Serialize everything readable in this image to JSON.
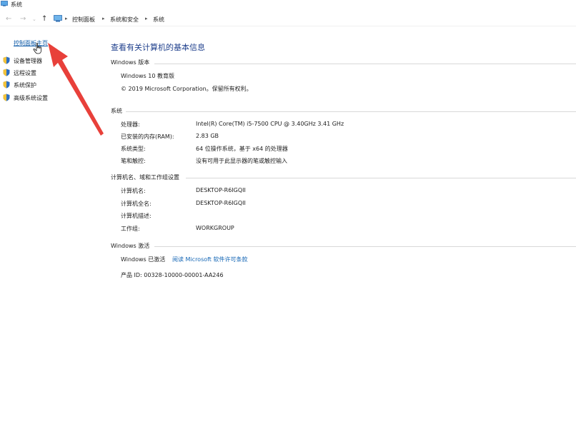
{
  "window": {
    "title": "系统"
  },
  "address": {
    "crumbs": [
      "控制面板",
      "系统和安全",
      "系统"
    ]
  },
  "sidebar": {
    "home_link": "控制面板主页",
    "tasks": [
      "设备管理器",
      "远程设置",
      "系统保护",
      "高级系统设置"
    ]
  },
  "main": {
    "title": "查看有关计算机的基本信息",
    "edition": {
      "header": "Windows 版本",
      "name": "Windows 10 教育版",
      "copyright": "© 2019 Microsoft Corporation。保留所有权利。"
    },
    "system": {
      "header": "系统",
      "rows": [
        {
          "label": "处理器:",
          "value": "Intel(R) Core(TM) i5-7500 CPU @ 3.40GHz   3.41 GHz"
        },
        {
          "label": "已安装的内存(RAM):",
          "value": "2.83 GB"
        },
        {
          "label": "系统类型:",
          "value": "64 位操作系统，基于 x64 的处理器"
        },
        {
          "label": "笔和触控:",
          "value": "没有可用于此显示器的笔或触控输入"
        }
      ]
    },
    "computer": {
      "header": "计算机名、域和工作组设置",
      "rows": [
        {
          "label": "计算机名:",
          "value": "DESKTOP-R6IGQII"
        },
        {
          "label": "计算机全名:",
          "value": "DESKTOP-R6IGQII"
        },
        {
          "label": "计算机描述:",
          "value": ""
        },
        {
          "label": "工作组:",
          "value": "WORKGROUP"
        }
      ]
    },
    "activation": {
      "header": "Windows 激活",
      "status": "Windows 已激活",
      "license_link": "阅读 Microsoft 软件许可条款",
      "product_id": "产品 ID: 00328-10000-00001-AA246"
    }
  },
  "colors": {
    "link": "#1466b5",
    "title": "#1e3f8c",
    "arrow": "#e8403a"
  }
}
